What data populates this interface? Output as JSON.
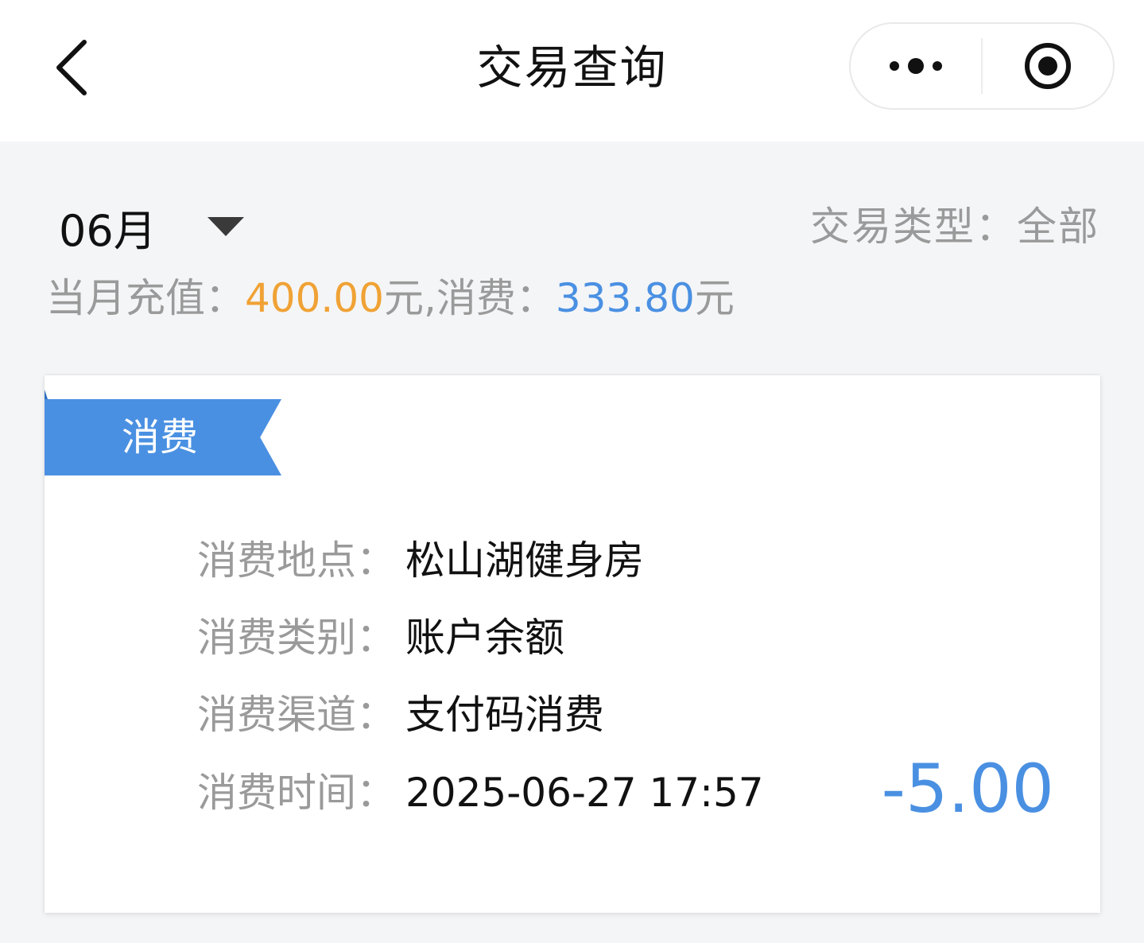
{
  "header": {
    "title": "交易查询",
    "back_icon": "chevron-left-icon",
    "more_icon": "more-dots-icon",
    "close_icon": "target-circle-icon"
  },
  "filters": {
    "month": "06月",
    "txn_type_label": "交易类型：",
    "txn_type_value": "全部"
  },
  "summary": {
    "prefix": "当月充值：",
    "recharge_amount": "400.00",
    "mid": "元,消费：",
    "spend_amount": "333.80",
    "suffix": "元"
  },
  "colors": {
    "accent_blue": "#4a90e2",
    "recharge_orange": "#f0a235",
    "label_gray": "#9a9a9a"
  },
  "transaction": {
    "tag": "消费",
    "rows": [
      {
        "label": "消费地点：",
        "value": "松山湖健身房"
      },
      {
        "label": "消费类别：",
        "value": "账户余额"
      },
      {
        "label": "消费渠道：",
        "value": "支付码消费"
      },
      {
        "label": "消费时间：",
        "value": "2025-06-27 17:57"
      }
    ],
    "amount": "-5.00"
  }
}
